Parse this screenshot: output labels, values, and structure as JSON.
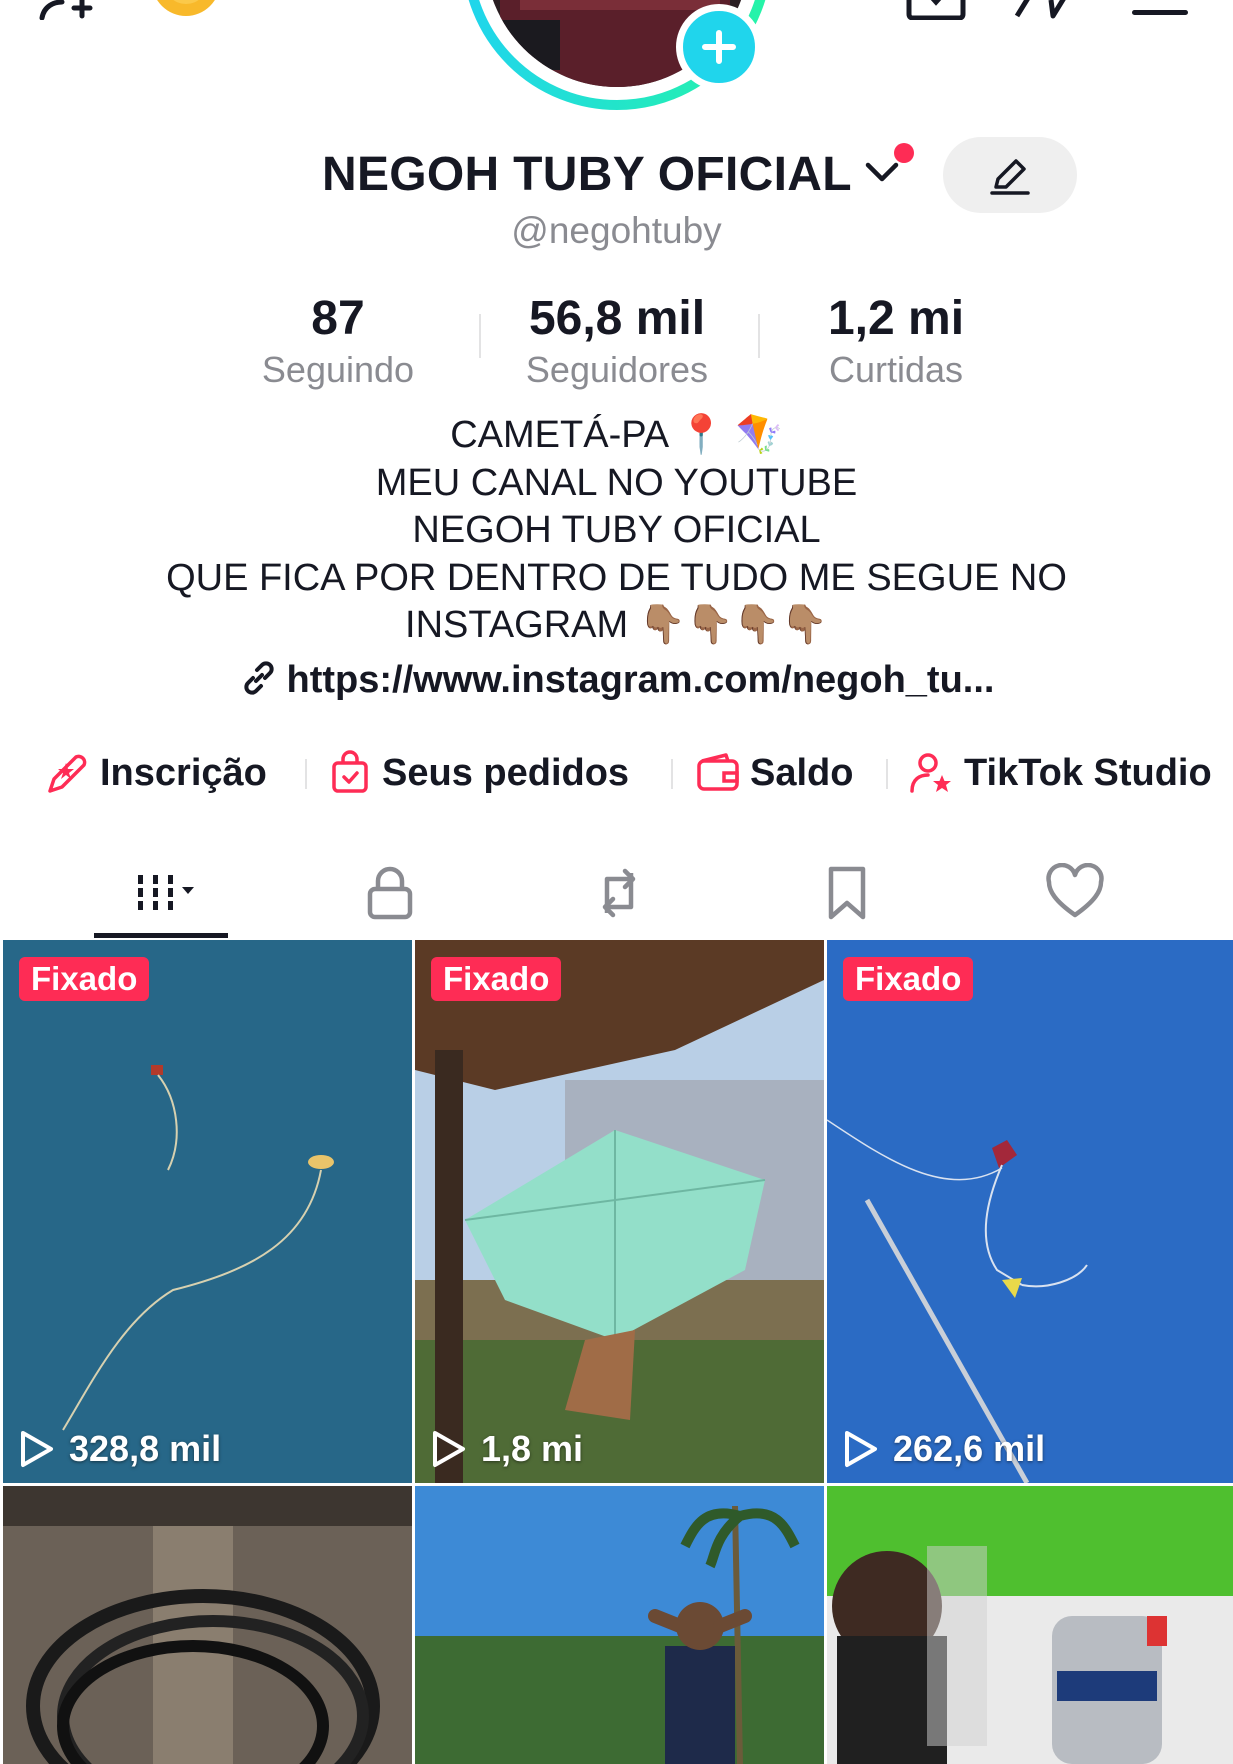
{
  "profile": {
    "display_name": "NEGOH TUBY OFICIAL",
    "username": "@negohtuby"
  },
  "stats": {
    "following_value": "87",
    "following_label": "Seguindo",
    "followers_value": "56,8 mil",
    "followers_label": "Seguidores",
    "likes_value": "1,2 mi",
    "likes_label": "Curtidas"
  },
  "bio": {
    "lines": [
      "CAMETÁ-PA 📍 🪁",
      "MEU CANAL NO YOUTUBE",
      "NEGOH TUBY OFICIAL",
      "QUE FICA POR DENTRO DE TUDO ME SEGUE NO",
      "INSTAGRAM 👇🏽👇🏽👇🏽👇🏽"
    ],
    "link": "https://www.instagram.com/negoh_tu..."
  },
  "shortcuts": [
    {
      "label": "Inscrição",
      "icon": "star-ticket-icon"
    },
    {
      "label": "Seus pedidos",
      "icon": "shopping-bag-icon"
    },
    {
      "label": "Saldo",
      "icon": "wallet-icon"
    },
    {
      "label": "TikTok Studio",
      "icon": "creator-studio-icon"
    }
  ],
  "tabs": [
    {
      "name": "videos",
      "icon": "grid-icon",
      "active": true
    },
    {
      "name": "private",
      "icon": "lock-icon"
    },
    {
      "name": "reposts",
      "icon": "repost-icon"
    },
    {
      "name": "favorites",
      "icon": "bookmark-icon"
    },
    {
      "name": "liked",
      "icon": "heart-icon"
    }
  ],
  "videos": [
    {
      "pinned_label": "Fixado",
      "views": "328,8 mil"
    },
    {
      "pinned_label": "Fixado",
      "views": "1,8 mi"
    },
    {
      "pinned_label": "Fixado",
      "views": "262,6 mil"
    }
  ],
  "colors": {
    "accent": "#fe2c55",
    "avatar_ring": "#20d5ec",
    "text_primary": "#161823",
    "text_secondary": "#8a8b91"
  }
}
